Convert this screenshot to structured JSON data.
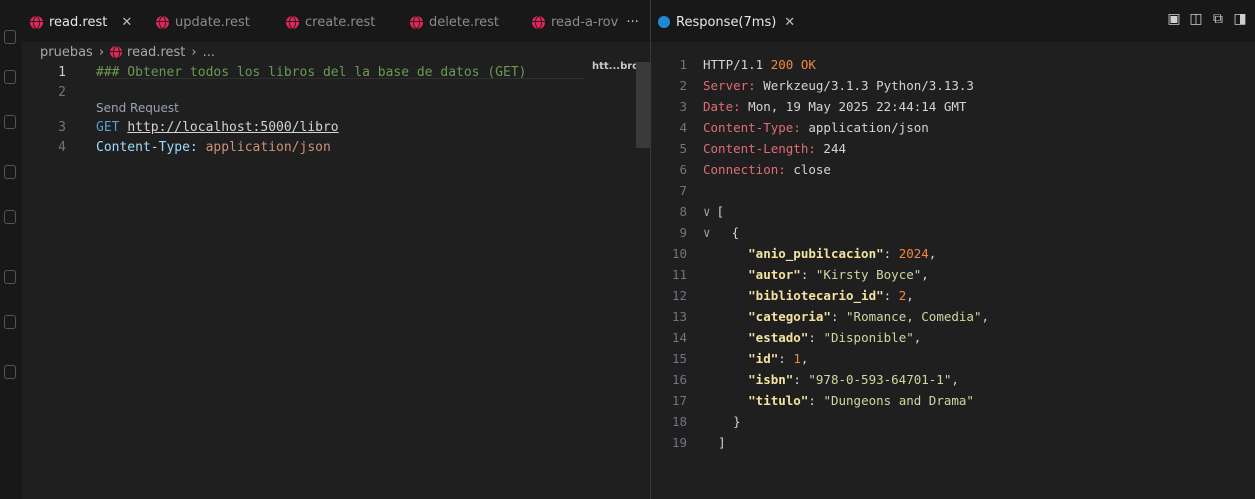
{
  "tabs": [
    {
      "label": "read.rest",
      "active": true,
      "closable": true
    },
    {
      "label": "update.rest",
      "active": false
    },
    {
      "label": "create.rest",
      "active": false
    },
    {
      "label": "delete.rest",
      "active": false
    },
    {
      "label": "read-a-rov",
      "active": false
    }
  ],
  "tabs_more": "···",
  "breadcrumb": {
    "folder": "pruebas",
    "file": "read.rest",
    "tail": "..."
  },
  "editor": {
    "codelens": "Send Request",
    "hint": "htt...bro",
    "lines": [
      {
        "n": "1",
        "text": "### Obtener todos los libros del la base de datos (GET)"
      },
      {
        "n": "2",
        "text": ""
      },
      {
        "n": "3",
        "method": "GET",
        "url": "http://localhost:5000/libro"
      },
      {
        "n": "4",
        "key": "Content-Type:",
        "value": "application/json"
      }
    ]
  },
  "response": {
    "tab_label": "Response(7ms)",
    "close": "✕",
    "header_lines": [
      {
        "n": "1",
        "a": "HTTP/1.1 ",
        "b": "200 OK"
      },
      {
        "n": "2",
        "a": "Server:",
        "b": " Werkzeug/3.1.3 Python/3.13.3"
      },
      {
        "n": "3",
        "a": "Date:",
        "b": " Mon, 19 May 2025 22:44:14 GMT"
      },
      {
        "n": "4",
        "a": "Content-Type:",
        "b": " application/json"
      },
      {
        "n": "5",
        "a": "Content-Length:",
        "b": " 244"
      },
      {
        "n": "6",
        "a": "Connection:",
        "b": " close"
      },
      {
        "n": "7",
        "a": "",
        "b": ""
      }
    ],
    "open_bracket": "[",
    "open_brace": "{",
    "close_brace": "}",
    "close_bracket": "]",
    "open_bracket_n": "8",
    "open_brace_n": "9",
    "close_brace_n": "18",
    "close_bracket_n": "19",
    "fields": [
      {
        "n": "10",
        "key": "\"anio_pubilcacion\"",
        "value": "2024",
        "type": "num"
      },
      {
        "n": "11",
        "key": "\"autor\"",
        "value": "\"Kirsty Boyce\"",
        "type": "str"
      },
      {
        "n": "12",
        "key": "\"bibliotecario_id\"",
        "value": "2",
        "type": "num"
      },
      {
        "n": "13",
        "key": "\"categoria\"",
        "value": "\"Romance, Comedia\"",
        "type": "str"
      },
      {
        "n": "14",
        "key": "\"estado\"",
        "value": "\"Disponible\"",
        "type": "str"
      },
      {
        "n": "15",
        "key": "\"id\"",
        "value": "1",
        "type": "num"
      },
      {
        "n": "16",
        "key": "\"isbn\"",
        "value": "\"978-0-593-64701-1\"",
        "type": "str"
      },
      {
        "n": "17",
        "key": "\"titulo\"",
        "value": "\"Dungeons and Drama\"",
        "type": "str",
        "last": true
      }
    ]
  }
}
